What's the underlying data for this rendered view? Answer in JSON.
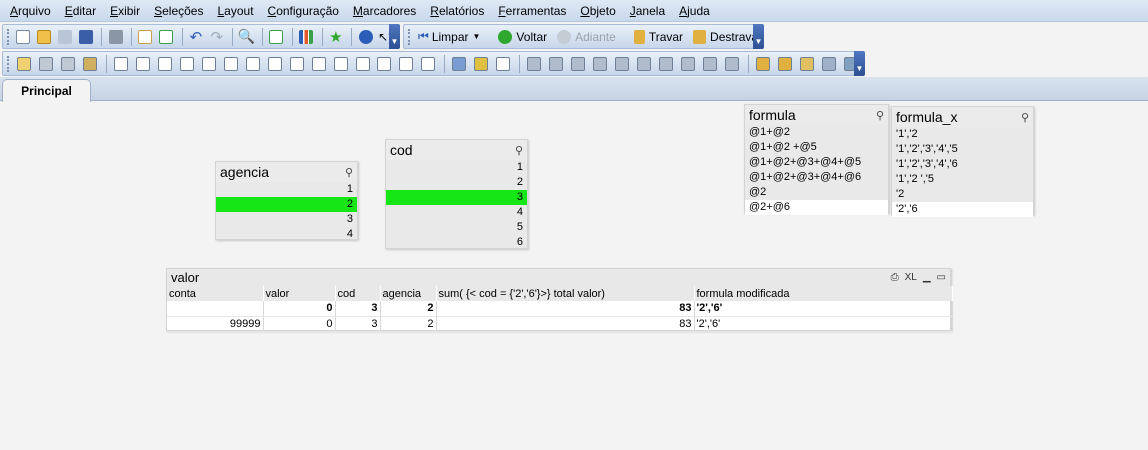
{
  "menu": {
    "items": [
      {
        "u": "A",
        "rest": "rquivo"
      },
      {
        "u": "E",
        "rest": "ditar"
      },
      {
        "u": "E",
        "rest": "xibir"
      },
      {
        "u": "S",
        "rest": "eleções"
      },
      {
        "u": "L",
        "rest": "ayout"
      },
      {
        "u": "C",
        "rest": "onfiguração"
      },
      {
        "u": "M",
        "rest": "arcadores"
      },
      {
        "u": "R",
        "rest": "elatórios"
      },
      {
        "u": "F",
        "rest": "erramentas"
      },
      {
        "u": "O",
        "rest": "bjeto"
      },
      {
        "u": "J",
        "rest": "anela"
      },
      {
        "u": "A",
        "rest": "juda"
      }
    ]
  },
  "toolbar2": {
    "limpar": "Limpar",
    "voltar": "Voltar",
    "adiante": "Adiante",
    "travar": "Travar",
    "destravar": "Destravar"
  },
  "tabs": [
    "Principal"
  ],
  "agencia": {
    "title": "agencia",
    "values": [
      "1",
      "2",
      "3",
      "4"
    ],
    "selected": "2"
  },
  "cod": {
    "title": "cod",
    "values": [
      "1",
      "2",
      "3",
      "4",
      "5",
      "6"
    ],
    "selected": "3"
  },
  "formula": {
    "title": "formula",
    "values": [
      "@1+@2",
      "@1+@2 +@5",
      "@1+@2+@3+@4+@5",
      "@1+@2+@3+@4+@6",
      "@2",
      "@2+@6"
    ]
  },
  "formula_x": {
    "title": "formula_x",
    "values": [
      "'1','2",
      "'1','2','3','4','5",
      "'1','2','3','4','6",
      "'1','2 ','5",
      "'2",
      "'2','6"
    ]
  },
  "valor_table": {
    "title": "valor",
    "xl_label": "XL",
    "headers": [
      "conta",
      "valor",
      "cod",
      "agencia",
      "sum( {< cod = {'2','6'}>}  total valor)",
      "formula modificada"
    ],
    "total_row": [
      "",
      "0",
      "3",
      "2",
      "83",
      "'2','6'"
    ],
    "rows": [
      [
        "99999",
        "0",
        "3",
        "2",
        "83",
        "'2','6'"
      ]
    ]
  },
  "colors": {
    "selected": "#16e616",
    "accent": "#2d4f93"
  }
}
